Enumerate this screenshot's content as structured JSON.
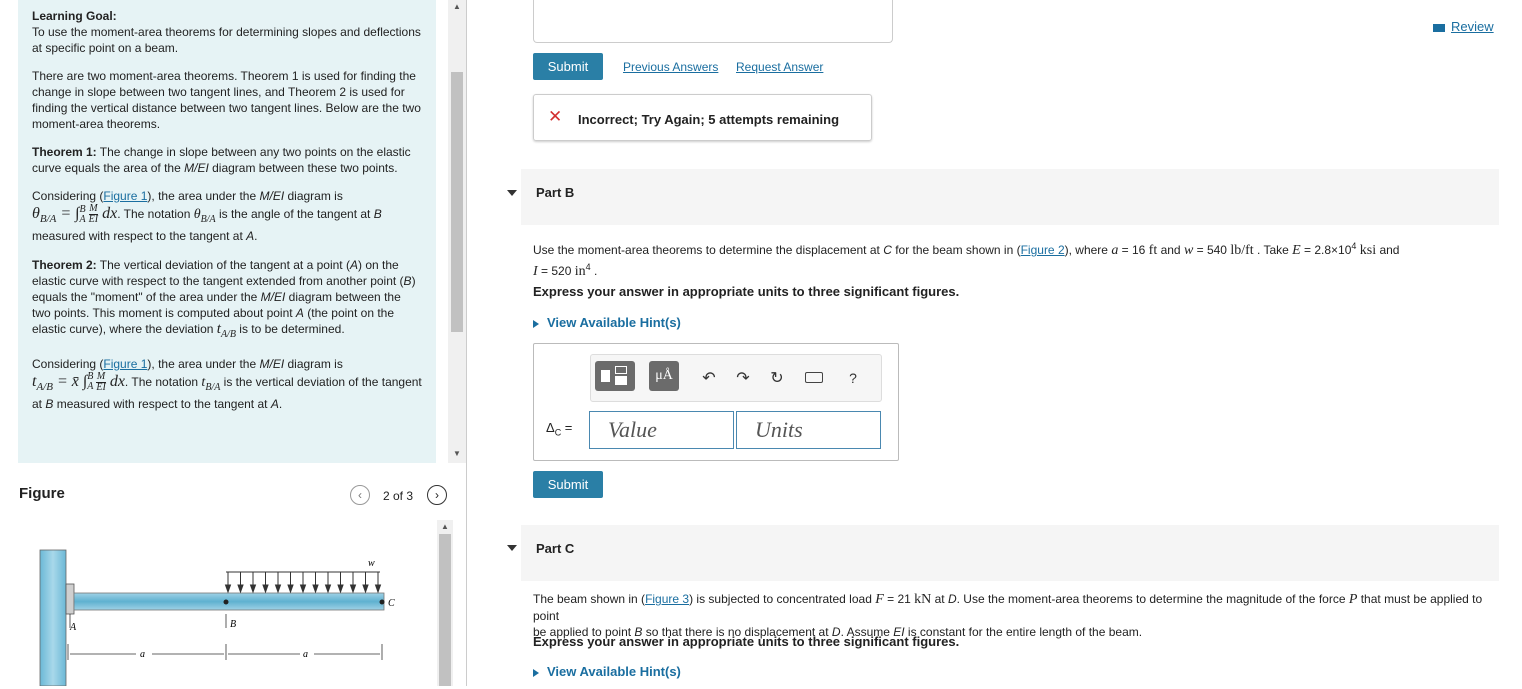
{
  "goal": {
    "heading": "Learning Goal:",
    "text": "To use the moment-area theorems for determining slopes and deflections at specific point on a beam.",
    "intro": "There are two moment-area theorems. Theorem 1 is used for finding the change in slope between two tangent lines, and Theorem 2 is used for finding the vertical distance between two tangent lines. Below are the two moment-area theorems.",
    "theorem1_label": "Theorem 1:",
    "theorem1_a": " The change in slope between any two points on the elastic curve equals the area of the ",
    "theorem1_mei": "M/EI",
    "theorem1_b": " diagram between these two points.",
    "consider1_a": "Considering (",
    "consider1_link": "Figure 1",
    "consider1_b": "), the area under the ",
    "consider1_mei": "M/EI",
    "consider1_c": " diagram is",
    "notation1_a": ". The notation ",
    "notation1_b": " is the angle of the tangent at ",
    "notation1_B": "B",
    "notation1_c": " measured with respect to the tangent at ",
    "notation1_A": "A",
    "notation1_d": ".",
    "theorem2_label": "Theorem 2:",
    "theorem2_a": " The vertical deviation of the tangent at a point (",
    "theorem2_A": "A",
    "theorem2_b": ") on the elastic curve with respect to the tangent extended from another point (",
    "theorem2_B": "B",
    "theorem2_c": ") equals the \"moment\" of the area under the ",
    "theorem2_mei": "M/EI",
    "theorem2_d": " diagram between the two points. This moment is computed about point ",
    "theorem2_A2": "A",
    "theorem2_e": " (the point on the elastic curve), where the deviation ",
    "theorem2_f": " is to be determined.",
    "consider2_a": "Considering (",
    "consider2_link": "Figure 1",
    "consider2_b": "), the area under the ",
    "consider2_mei": "M/EI",
    "consider2_c": " diagram is",
    "notation2_a": ". The notation ",
    "notation2_b": " is the vertical deviation of the tangent at ",
    "notation2_B": "B",
    "notation2_c": " measured with respect to the tangent at ",
    "notation2_A": "A",
    "notation2_d": ".",
    "math": {
      "thetaBA": "θ",
      "sub_BA": "B/A",
      "eq": " = ",
      "int": "∫",
      "int_top": "B",
      "int_bot": "A",
      "frac_num": "M",
      "frac_den": "EI",
      "dx": " dx",
      "t": "t",
      "sub_AB": "A/B",
      "xbar": "x̄"
    }
  },
  "figure": {
    "title": "Figure",
    "pager": "2 of 3",
    "prev_icon": "chevron-left-icon",
    "next_icon": "chevron-right-icon",
    "labels": {
      "w": "w",
      "A": "A",
      "B": "B",
      "C": "C",
      "a1": "a",
      "a2": "a"
    }
  },
  "top": {
    "submit_label": "Submit",
    "previous_answers": "Previous Answers",
    "request_answer": "Request Answer",
    "review": "Review",
    "feedback": "Incorrect; Try Again; 5 attempts remaining"
  },
  "partB": {
    "title": "Part B",
    "q_a": "Use the moment-area theorems to determine the displacement at ",
    "q_C": "C",
    "q_b": " for the beam shown in (",
    "q_link": "Figure 2",
    "q_c": "), where ",
    "q_a_var": "a",
    "q_d": " = 16 ",
    "q_ft": "ft",
    "q_e": " and ",
    "q_w_var": "w",
    "q_f": " = 540 ",
    "q_lbft": "lb/ft",
    "q_g": " . Take ",
    "q_E_var": "E",
    "q_h": " = 2.8×10",
    "q_h_exp": "4",
    "q_ksi": "ksi",
    "q_i": " and",
    "q_I_var": "I",
    "q_j": " = 520 ",
    "q_in": "in",
    "q_in_exp": "4",
    "q_k": " .",
    "instruction": "Express your answer in appropriate units to three significant figures.",
    "hint": "View Available Hint(s)",
    "delta_label": "Δ",
    "delta_sub": "C",
    "delta_eq": " =",
    "value_placeholder": "Value",
    "units_placeholder": "Units",
    "submit_label": "Submit",
    "toolbar": {
      "units_btn": "μÅ",
      "help": "?"
    }
  },
  "partC": {
    "title": "Part C",
    "q_a": "The beam shown in (",
    "q_link": "Figure 3",
    "q_b": ") is subjected to concentrated load ",
    "q_F_var": "F",
    "q_c": " = 21 ",
    "q_kN": "kN",
    "q_d": " at ",
    "q_D": "D",
    "q_e": ". Use the moment-area theorems to determine the magnitude of the force ",
    "q_P_var": "P",
    "q_f": " that must be applied to point ",
    "q_B": "B",
    "q_g": " so that there is no displacement at ",
    "q_D2": "D",
    "q_h": ". Assume ",
    "q_EI": "EI",
    "q_i": " is constant for the entire length of the beam.",
    "instruction": "Express your answer in appropriate units to three significant figures.",
    "hint": "View Available Hint(s)"
  },
  "colors": {
    "accent": "#2a7fa6",
    "panel": "#e6f3f5",
    "error": "#d32f2f",
    "link": "#1a6ea0"
  }
}
